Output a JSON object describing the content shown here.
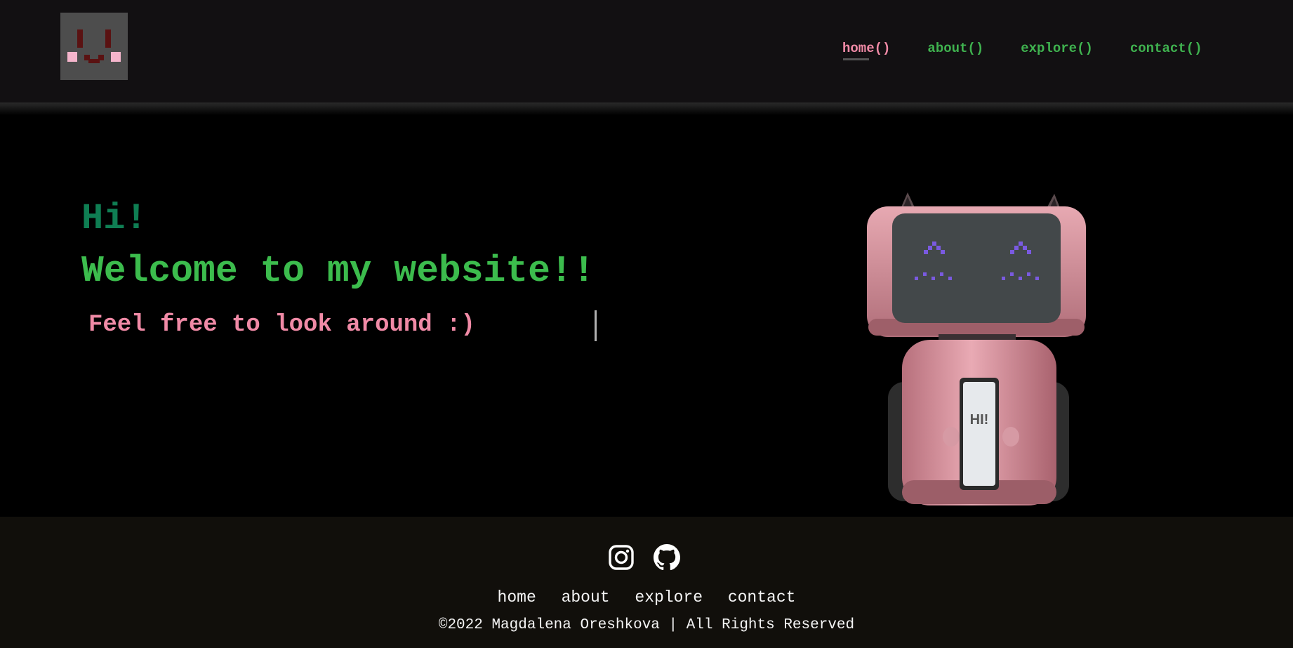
{
  "header": {
    "logo_icon": "pixel-face-logo-icon",
    "nav": [
      {
        "label": "home()",
        "active": true
      },
      {
        "label": "about()",
        "active": false
      },
      {
        "label": "explore()",
        "active": false
      },
      {
        "label": "contact()",
        "active": false
      }
    ]
  },
  "hero": {
    "greeting": "Hi!",
    "welcome": "Welcome to my website!!",
    "subtitle": "Feel free to look around :)",
    "robot_screen_text": "HI!",
    "robot_icon": "pink-robot-illustration"
  },
  "footer": {
    "social": [
      {
        "icon": "instagram-icon"
      },
      {
        "icon": "github-icon"
      }
    ],
    "links": [
      {
        "label": "home"
      },
      {
        "label": "about"
      },
      {
        "label": "explore"
      },
      {
        "label": "contact"
      }
    ],
    "copyright": "©2022 Magdalena Oreshkova | All Rights Reserved"
  },
  "colors": {
    "accent_green": "#3cbc4d",
    "dark_green": "#0f7e53",
    "accent_pink": "#f08aa6",
    "header_bg": "#121012",
    "footer_bg": "#110f0b",
    "robot_screen_eyes": "#7a5ae0"
  }
}
